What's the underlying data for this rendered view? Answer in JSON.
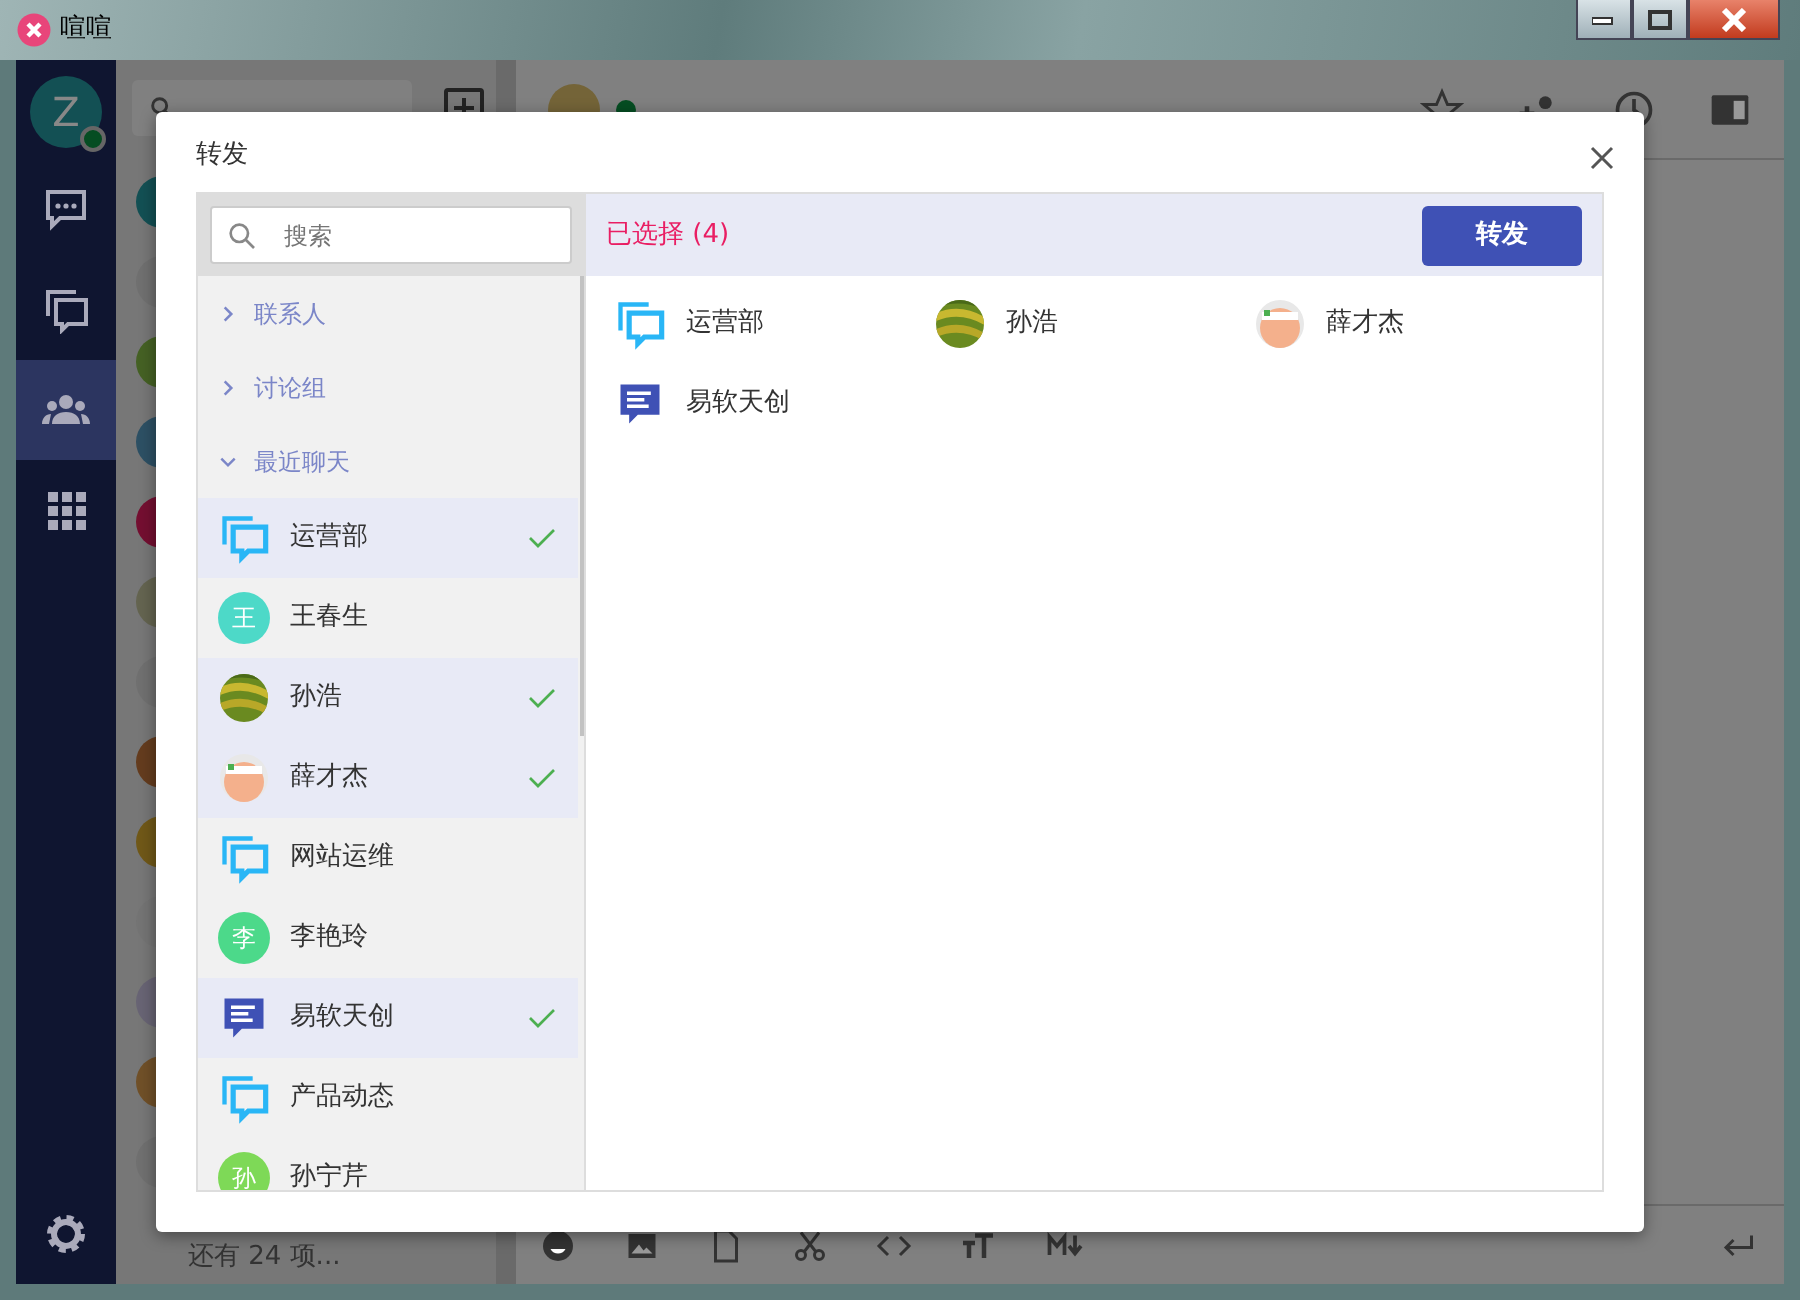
{
  "window": {
    "title": "喧喧"
  },
  "nav": {
    "user_letter": "Z",
    "online": true,
    "items": [
      {
        "kind": "chat",
        "selected": false
      },
      {
        "kind": "chats",
        "selected": false
      },
      {
        "kind": "contacts",
        "selected": true
      },
      {
        "kind": "apps",
        "selected": false
      }
    ]
  },
  "chat_list": {
    "more": "还有 24 项...",
    "avatars": [
      {
        "color": "#135054"
      },
      {
        "color": "#707070"
      },
      {
        "color": "#456124"
      },
      {
        "color": "#2d5064"
      },
      {
        "color": "#740f31"
      },
      {
        "color": "#646450"
      },
      {
        "color": "#707070"
      },
      {
        "color": "#643c1e"
      },
      {
        "color": "#705818"
      },
      {
        "color": "#747474"
      },
      {
        "color": "#686474"
      },
      {
        "color": "#705028"
      },
      {
        "color": "#707070"
      }
    ]
  },
  "dialog": {
    "title": "转发",
    "search_placeholder": "搜索",
    "groups": [
      {
        "label": "联系人",
        "expanded": false
      },
      {
        "label": "讨论组",
        "expanded": false
      },
      {
        "label": "最近聊天",
        "expanded": true
      }
    ],
    "recent": [
      {
        "name": "运营部",
        "kind": "group",
        "selected": true
      },
      {
        "name": "王春生",
        "kind": "letter",
        "letter": "王",
        "color": "#4dd9c8",
        "selected": false
      },
      {
        "name": "孙浩",
        "selected": true
      },
      {
        "name": "薛才杰",
        "kind": "photo2",
        "selected": true
      },
      {
        "name": "网站运维",
        "kind": "group",
        "selected": false
      },
      {
        "name": "李艳玲",
        "kind": "letter",
        "letter": "李",
        "color": "#4cd98a",
        "selected": false
      },
      {
        "name": "易软天创",
        "kind": "channel",
        "selected": true
      },
      {
        "name": "产品动态",
        "kind": "group",
        "selected": false
      },
      {
        "name": "孙宁芹",
        "kind": "letter",
        "letter": "孙",
        "color": "#7ed957",
        "selected": false
      }
    ],
    "selected_label": "已选择 (4)",
    "forward_button": "转发",
    "chosen": [
      {
        "name": "运营部",
        "kind": "group"
      },
      {
        "name": "孙浩"
      },
      {
        "name": "薛才杰",
        "kind": "photo2"
      },
      {
        "name": "易软天创",
        "kind": "channel"
      }
    ]
  }
}
